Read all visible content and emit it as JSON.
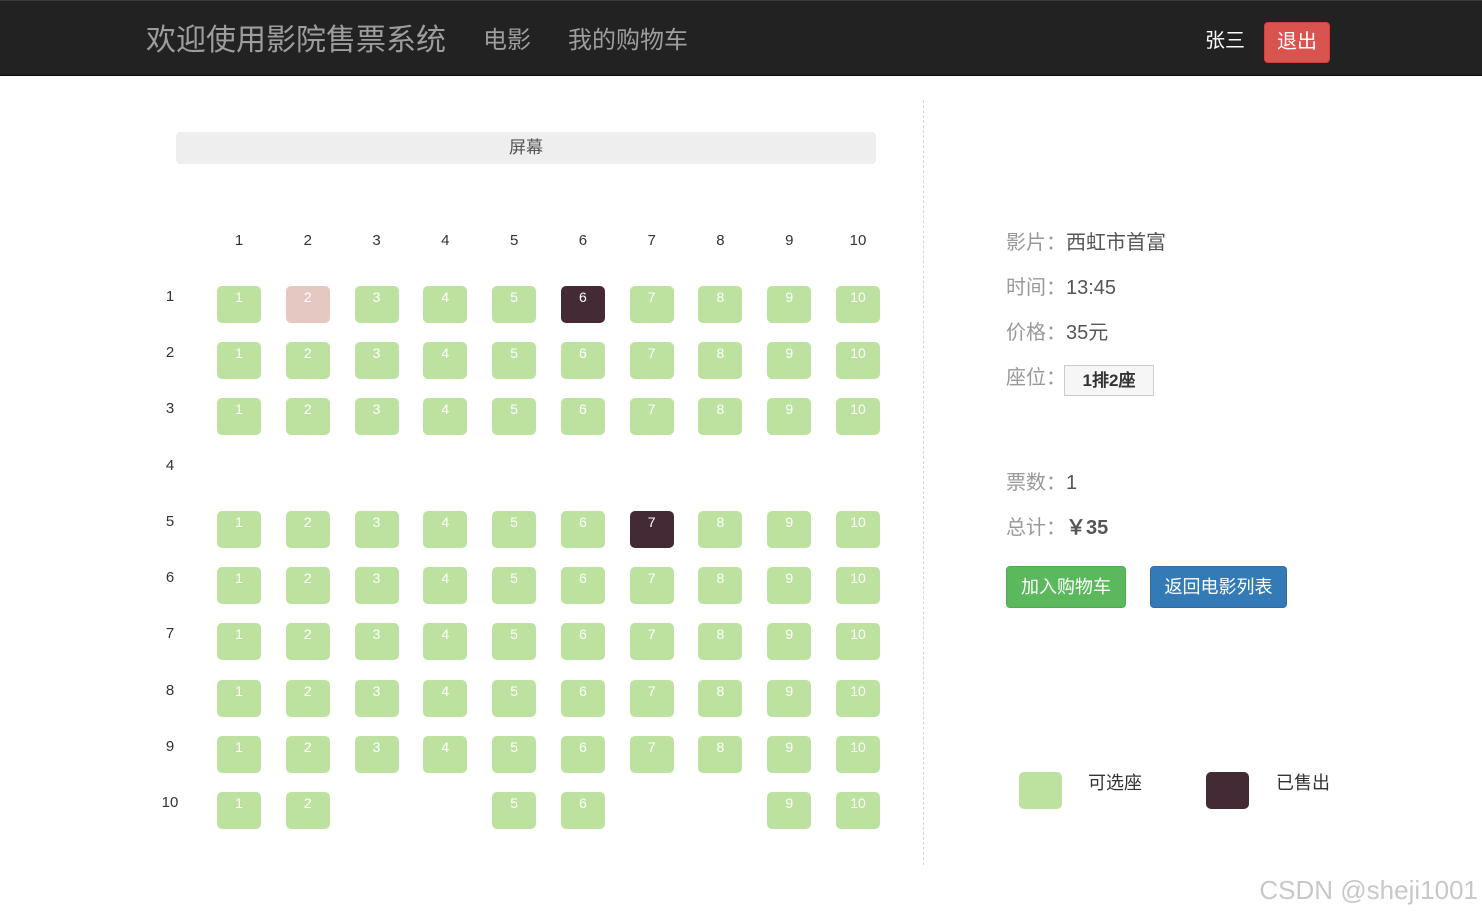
{
  "navbar": {
    "brand": "欢迎使用影院售票系统",
    "links": [
      {
        "label": "电影"
      },
      {
        "label": "我的购物车"
      }
    ],
    "user": "张三",
    "logout_label": "退出"
  },
  "screen_label": "屏幕",
  "seat_map": {
    "columns": [
      "1",
      "2",
      "3",
      "4",
      "5",
      "6",
      "7",
      "8",
      "9",
      "10"
    ],
    "rows": [
      {
        "label": "1",
        "seats": [
          {
            "num": "1",
            "status": "available"
          },
          {
            "num": "2",
            "status": "selected"
          },
          {
            "num": "3",
            "status": "available"
          },
          {
            "num": "4",
            "status": "available"
          },
          {
            "num": "5",
            "status": "available"
          },
          {
            "num": "6",
            "status": "sold"
          },
          {
            "num": "7",
            "status": "available"
          },
          {
            "num": "8",
            "status": "available"
          },
          {
            "num": "9",
            "status": "available"
          },
          {
            "num": "10",
            "status": "available"
          }
        ]
      },
      {
        "label": "2",
        "seats": [
          {
            "num": "1",
            "status": "available"
          },
          {
            "num": "2",
            "status": "available"
          },
          {
            "num": "3",
            "status": "available"
          },
          {
            "num": "4",
            "status": "available"
          },
          {
            "num": "5",
            "status": "available"
          },
          {
            "num": "6",
            "status": "available"
          },
          {
            "num": "7",
            "status": "available"
          },
          {
            "num": "8",
            "status": "available"
          },
          {
            "num": "9",
            "status": "available"
          },
          {
            "num": "10",
            "status": "available"
          }
        ]
      },
      {
        "label": "3",
        "seats": [
          {
            "num": "1",
            "status": "available"
          },
          {
            "num": "2",
            "status": "available"
          },
          {
            "num": "3",
            "status": "available"
          },
          {
            "num": "4",
            "status": "available"
          },
          {
            "num": "5",
            "status": "available"
          },
          {
            "num": "6",
            "status": "available"
          },
          {
            "num": "7",
            "status": "available"
          },
          {
            "num": "8",
            "status": "available"
          },
          {
            "num": "9",
            "status": "available"
          },
          {
            "num": "10",
            "status": "available"
          }
        ]
      },
      {
        "label": "4",
        "seats": []
      },
      {
        "label": "5",
        "seats": [
          {
            "num": "1",
            "status": "available"
          },
          {
            "num": "2",
            "status": "available"
          },
          {
            "num": "3",
            "status": "available"
          },
          {
            "num": "4",
            "status": "available"
          },
          {
            "num": "5",
            "status": "available"
          },
          {
            "num": "6",
            "status": "available"
          },
          {
            "num": "7",
            "status": "sold"
          },
          {
            "num": "8",
            "status": "available"
          },
          {
            "num": "9",
            "status": "available"
          },
          {
            "num": "10",
            "status": "available"
          }
        ]
      },
      {
        "label": "6",
        "seats": [
          {
            "num": "1",
            "status": "available"
          },
          {
            "num": "2",
            "status": "available"
          },
          {
            "num": "3",
            "status": "available"
          },
          {
            "num": "4",
            "status": "available"
          },
          {
            "num": "5",
            "status": "available"
          },
          {
            "num": "6",
            "status": "available"
          },
          {
            "num": "7",
            "status": "available"
          },
          {
            "num": "8",
            "status": "available"
          },
          {
            "num": "9",
            "status": "available"
          },
          {
            "num": "10",
            "status": "available"
          }
        ]
      },
      {
        "label": "7",
        "seats": [
          {
            "num": "1",
            "status": "available"
          },
          {
            "num": "2",
            "status": "available"
          },
          {
            "num": "3",
            "status": "available"
          },
          {
            "num": "4",
            "status": "available"
          },
          {
            "num": "5",
            "status": "available"
          },
          {
            "num": "6",
            "status": "available"
          },
          {
            "num": "7",
            "status": "available"
          },
          {
            "num": "8",
            "status": "available"
          },
          {
            "num": "9",
            "status": "available"
          },
          {
            "num": "10",
            "status": "available"
          }
        ]
      },
      {
        "label": "8",
        "seats": [
          {
            "num": "1",
            "status": "available"
          },
          {
            "num": "2",
            "status": "available"
          },
          {
            "num": "3",
            "status": "available"
          },
          {
            "num": "4",
            "status": "available"
          },
          {
            "num": "5",
            "status": "available"
          },
          {
            "num": "6",
            "status": "available"
          },
          {
            "num": "7",
            "status": "available"
          },
          {
            "num": "8",
            "status": "available"
          },
          {
            "num": "9",
            "status": "available"
          },
          {
            "num": "10",
            "status": "available"
          }
        ]
      },
      {
        "label": "9",
        "seats": [
          {
            "num": "1",
            "status": "available"
          },
          {
            "num": "2",
            "status": "available"
          },
          {
            "num": "3",
            "status": "available"
          },
          {
            "num": "4",
            "status": "available"
          },
          {
            "num": "5",
            "status": "available"
          },
          {
            "num": "6",
            "status": "available"
          },
          {
            "num": "7",
            "status": "available"
          },
          {
            "num": "8",
            "status": "available"
          },
          {
            "num": "9",
            "status": "available"
          },
          {
            "num": "10",
            "status": "available"
          }
        ]
      },
      {
        "label": "10",
        "seats": [
          {
            "num": "1",
            "status": "available"
          },
          {
            "num": "2",
            "status": "available"
          },
          {
            "num": "5",
            "status": "available"
          },
          {
            "num": "6",
            "status": "available"
          },
          {
            "num": "9",
            "status": "available"
          },
          {
            "num": "10",
            "status": "available"
          }
        ]
      }
    ]
  },
  "info": {
    "film": {
      "label": "影片：",
      "value": "西虹市首富"
    },
    "time": {
      "label": "时间：",
      "value": "13:45"
    },
    "price": {
      "label": "价格：",
      "value": "35元"
    },
    "seat": {
      "label": "座位：",
      "value": "1排2座"
    },
    "tickets": {
      "label": "票数：",
      "value": "1"
    },
    "total": {
      "label": "总计：",
      "value": "￥35"
    }
  },
  "actions": {
    "add_to_cart": "加入购物车",
    "back_to_list": "返回电影列表"
  },
  "legend": [
    {
      "label": "可选座",
      "status": "available"
    },
    {
      "label": "已售出",
      "status": "sold"
    }
  ],
  "watermark": "CSDN @sheji1001",
  "colors": {
    "navbar_bg": "#222222",
    "nav_text": "#9d9d9d",
    "logout_button": "#d9534f",
    "screen_bar": "#eeeeee",
    "seat_available": "#bde2a0",
    "seat_selected": "#e6c8c2",
    "seat_sold": "#432a35",
    "add_to_cart_button": "#5cb85c",
    "back_button": "#337ab7"
  }
}
